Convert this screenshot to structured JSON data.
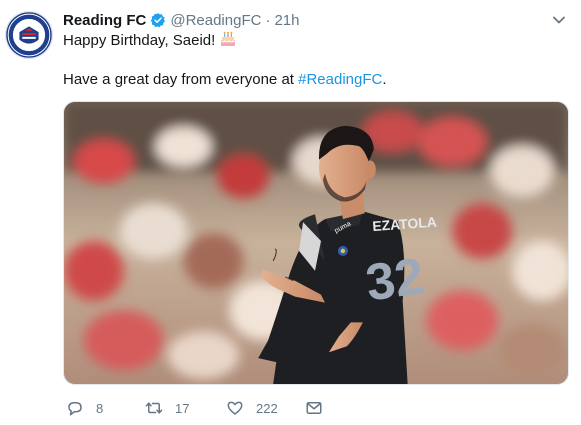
{
  "tweet": {
    "author_name": "Reading FC",
    "author_handle": "@ReadingFC",
    "separator": "·",
    "time": "21h",
    "text_line1": "Happy Birthday, Saeid!",
    "text_line2_prefix": "Have a great day from everyone at ",
    "hashtag": "#ReadingFC",
    "text_line2_suffix": ".",
    "media_alt": "Reading FC player in black kit",
    "player_shirt_text": "EZATOLA",
    "player_number": "32"
  },
  "actions": {
    "replies": "8",
    "retweets": "17",
    "likes": "222"
  },
  "colors": {
    "link": "#1b95e0",
    "verified": "#1da1f2",
    "secondary_text": "#657786",
    "primary_text": "#14171a",
    "kit": "#1e1f22"
  },
  "icons": [
    "club-crest-icon",
    "verified-badge-icon",
    "chevron-down-icon",
    "birthday-cake-icon",
    "reply-icon",
    "retweet-icon",
    "like-icon",
    "direct-message-icon"
  ]
}
